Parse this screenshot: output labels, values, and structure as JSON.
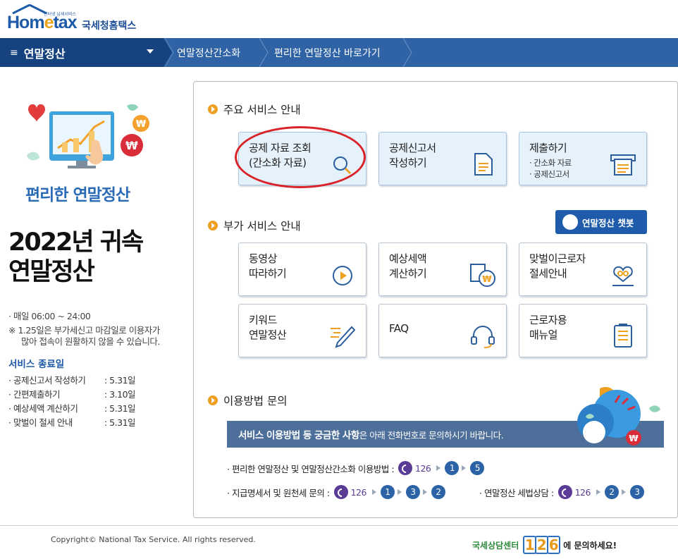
{
  "header": {
    "logo_tagline": "인터넷 납세서비스",
    "logo_home": "Hom",
    "logo_e": "e",
    "logo_tax": "tax",
    "logo_korean": "국세청홈택스"
  },
  "nav": {
    "menu_icon": "hamburger-icon",
    "menu_label": "연말정산",
    "crumbs": [
      "연말정산간소화",
      "편리한 연말정산 바로가기"
    ]
  },
  "left": {
    "promo_title": "편리한 연말정산",
    "title_line1": "2022년 귀속",
    "title_line2": "연말정산",
    "hours": "· 매일 06:00 ~ 24:00",
    "note1": "※ 1.25일은 부가세신고 마감일로 이용자가",
    "note2": "많아 접속이 원활하지 않을 수 있습니다.",
    "end_heading": "서비스 종료일",
    "end_items": [
      {
        "name": "· 공제신고서 작성하기",
        "date": ": 5.31일"
      },
      {
        "name": "· 간편제출하기",
        "date": ": 3.10일"
      },
      {
        "name": "· 예상세액 계산하기",
        "date": ": 5.31일"
      },
      {
        "name": "· 맞벌이 절세 안내",
        "date": ": 5.31일"
      }
    ]
  },
  "main_services": {
    "heading": "주요 서비스 안내",
    "cards": [
      {
        "title": "공제 자료 조회\n(간소화 자료)",
        "icon": "search-icon"
      },
      {
        "title": "공제신고서\n작성하기",
        "icon": "document-icon"
      },
      {
        "title": "제출하기",
        "sub1": "· 간소화 자료",
        "sub2": "· 공제신고서",
        "icon": "submit-icon"
      }
    ]
  },
  "extra_services": {
    "heading": "부가 서비스 안내",
    "chatbot_label": "연말정산 챗봇",
    "cards": [
      {
        "title": "동영상\n따라하기",
        "icon": "play-icon"
      },
      {
        "title": "예상세액\n계산하기",
        "icon": "calculator-won-icon"
      },
      {
        "title": "맞벌이근로자\n절세안내",
        "icon": "couple-hand-icon"
      },
      {
        "title": "키워드\n연말정산",
        "icon": "pencil-icon"
      },
      {
        "title": "FAQ",
        "icon": "headset-icon"
      },
      {
        "title": "근로자용\n매뉴얼",
        "icon": "manual-icon"
      }
    ]
  },
  "inquiry": {
    "heading": "이용방법 문의",
    "banner_bold": "서비스 이용방법 등 궁금한 사항",
    "banner_rest": "은 아래 전화번호로 문의하시기 바랍니다.",
    "row1_label": "· 편리한 연말정산 및 연말정산간소화 이용방법 :",
    "row1_steps": [
      "1",
      "5"
    ],
    "row2_label": "· 지급명세서 및 원천세 문의 :",
    "row2_steps": [
      "1",
      "3",
      "2"
    ],
    "row3_label": "· 연말정산 세법상담 :",
    "row3_steps": [
      "2",
      "3"
    ],
    "phone_number": "126"
  },
  "footer": {
    "copyright": "Copyright© National Tax Service. All rights reserved.",
    "center_label": "국세상담센터",
    "center_digits": [
      "1",
      "2",
      "6"
    ],
    "center_ask": "에 문의하세요!"
  },
  "colors": {
    "nav_dark": "#16427f",
    "nav": "#2f63a6",
    "accent": "#f0a020",
    "highlight_oval": "#d9232a"
  }
}
